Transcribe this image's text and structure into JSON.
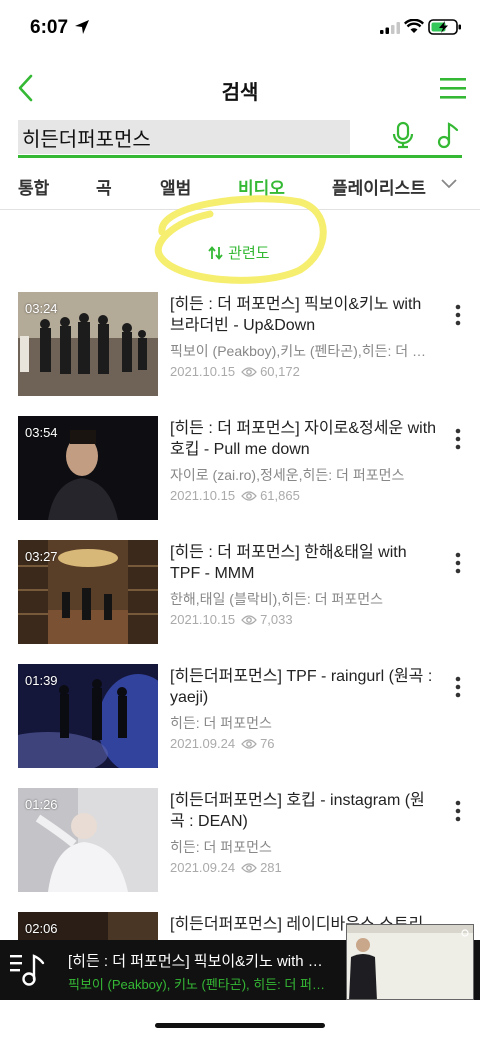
{
  "status_bar": {
    "time": "6:07"
  },
  "header": {
    "title": "검색"
  },
  "search": {
    "value": "히든더퍼포먼스"
  },
  "tabs": [
    {
      "label": "통합",
      "active": false
    },
    {
      "label": "곡",
      "active": false
    },
    {
      "label": "앨범",
      "active": false
    },
    {
      "label": "비디오",
      "active": true
    },
    {
      "label": "플레이리스트",
      "active": false
    }
  ],
  "sort": {
    "label": "관련도",
    "icon": "sort-arrows-icon"
  },
  "results": [
    {
      "duration": "03:24",
      "title": "[히든 : 더 퍼포먼스] 픽보이&키노 with 브라더빈 - Up&Down",
      "artist": "픽보이 (Peakboy),키노 (펜타곤),히든: 더 퍼포먼스",
      "date": "2021.10.15",
      "views": "60,172"
    },
    {
      "duration": "03:54",
      "title": "[히든 : 더 퍼포먼스] 자이로&정세운 with 호킵 - Pull me down",
      "artist": "자이로 (zai.ro),정세운,히든: 더 퍼포먼스",
      "date": "2021.10.15",
      "views": "61,865"
    },
    {
      "duration": "03:27",
      "title": "[히든 : 더 퍼포먼스] 한해&태일 with TPF - MMM",
      "artist": "한해,태일 (블락비),히든: 더 퍼포먼스",
      "date": "2021.10.15",
      "views": "7,033"
    },
    {
      "duration": "01:39",
      "title": "[히든더퍼포먼스] TPF - raingurl (원곡 : yaeji)",
      "artist": "히든: 더 퍼포먼스",
      "date": "2021.09.24",
      "views": "76"
    },
    {
      "duration": "01:26",
      "title": "[히든더퍼포먼스] 호킵 - instagram (원곡 : DEAN)",
      "artist": "히든: 더 퍼포먼스",
      "date": "2021.09.24",
      "views": "281"
    },
    {
      "duration": "02:06",
      "title": "[히든더퍼포먼스] 레이디바운스 스토리",
      "artist": "",
      "date": "",
      "views": ""
    }
  ],
  "player": {
    "title": "[히든 : 더 퍼포먼스] 픽보이&키노 with 브라더빈 - Up&Down",
    "artist": "픽보이 (Peakboy), 키노 (펜타곤), 히든: 더 퍼포먼스"
  },
  "colors": {
    "accent": "#35b935",
    "highlight": "#f5ee6e",
    "player_bg": "#111111"
  }
}
